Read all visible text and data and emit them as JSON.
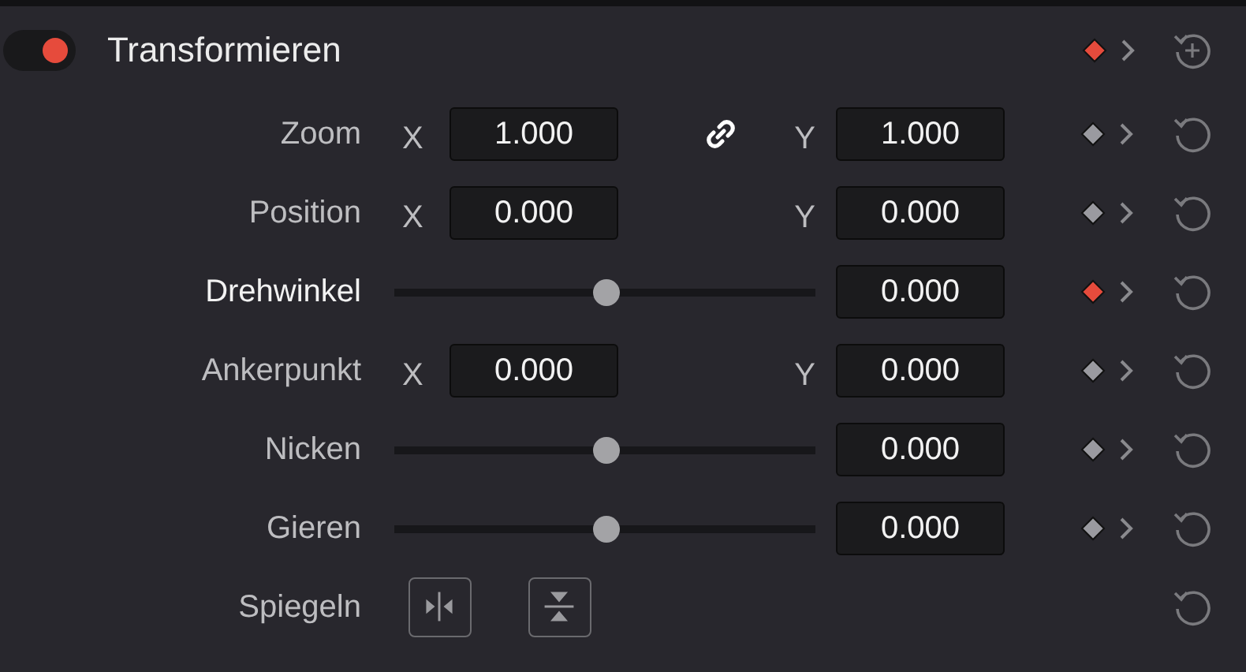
{
  "section": {
    "title": "Transformieren",
    "enabled": true,
    "keyframed": true
  },
  "rows": [
    {
      "kind": "xy",
      "label": "Zoom",
      "x_label": "X",
      "x_value": "1.000",
      "linked": true,
      "y_label": "Y",
      "y_value": "1.000",
      "keyframed": false
    },
    {
      "kind": "xy",
      "label": "Position",
      "x_label": "X",
      "x_value": "0.000",
      "linked": false,
      "y_label": "Y",
      "y_value": "0.000",
      "keyframed": false
    },
    {
      "kind": "slider",
      "label": "Drehwinkel",
      "level": 0.5,
      "value": "0.000",
      "keyframed": true
    },
    {
      "kind": "xy",
      "label": "Ankerpunkt",
      "x_label": "X",
      "x_value": "0.000",
      "linked": false,
      "y_label": "Y",
      "y_value": "0.000",
      "keyframed": false
    },
    {
      "kind": "slider",
      "label": "Nicken",
      "level": 0.5,
      "value": "0.000",
      "keyframed": false
    },
    {
      "kind": "slider",
      "label": "Gieren",
      "level": 0.5,
      "value": "0.000",
      "keyframed": false
    },
    {
      "kind": "flip",
      "label": "Spiegeln"
    }
  ]
}
